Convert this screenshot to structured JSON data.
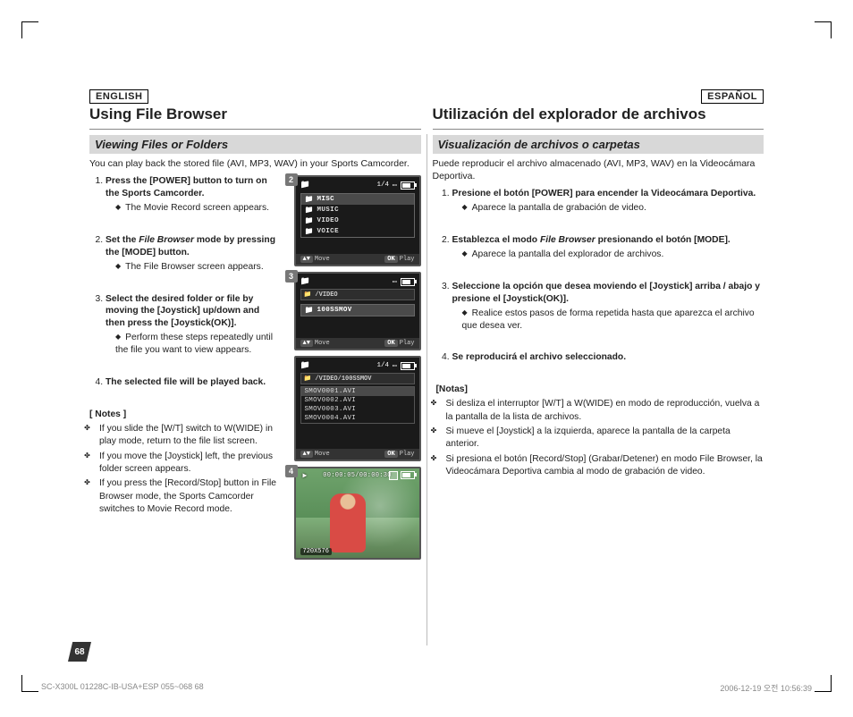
{
  "page_number": "68",
  "footer": {
    "doc_id": "SC-X300L 01228C-IB-USA+ESP 055~068   68",
    "timestamp": "2006-12-19   오전 10:56:39"
  },
  "figures": {
    "step_labels": [
      "2",
      "3",
      "4"
    ],
    "counter": "1/4",
    "folders": [
      "MISC",
      "MUSIC",
      "VIDEO",
      "VOICE"
    ],
    "path_step3": "/VIDEO",
    "path_step3_sub": "100SSMOV",
    "path_step4": "/VIDEO/100SSMOV",
    "files": [
      "SMOV0001.AVI",
      "SMOV0002.AVI",
      "SMOV0003.AVI",
      "SMOV0004.AVI"
    ],
    "bottom_move": "Move",
    "bottom_play": "Play",
    "move_key": "▲▼",
    "ok_key": "OK",
    "play_time": "00:00:05/00:00:30",
    "resolution": "720X576"
  },
  "left": {
    "lang": "ENGLISH",
    "title": "Using File Browser",
    "subheading": "Viewing Files or Folders",
    "intro": "You can play back the stored file (AVI, MP3, WAV) in your Sports Camcorder.",
    "steps": [
      {
        "title": "Press the [POWER] button to turn on the Sports Camcorder.",
        "sub": [
          "The Movie Record screen appears."
        ],
        "mode_label": null
      },
      {
        "title_pre": "Set the ",
        "mode_label": "File Browser",
        "title_post": " mode by pressing the [MODE] button.",
        "sub": [
          "The File Browser screen appears."
        ]
      },
      {
        "title": "Select the desired folder or file by moving the [Joystick] up/down and then press the [Joystick(OK)].",
        "sub": [
          "Perform these steps repeatedly until the file you want to view appears."
        ]
      },
      {
        "title": "The selected file will be played back.",
        "sub": []
      }
    ],
    "notes_head": "[ Notes ]",
    "notes": [
      "If you slide the [W/T] switch to W(WIDE) in play mode, return to the file list screen.",
      "If you move the [Joystick] left, the previous folder screen appears.",
      "If you press the [Record/Stop] button in File Browser mode, the Sports Camcorder switches to Movie Record mode."
    ]
  },
  "right": {
    "lang": "ESPAÑOL",
    "title": "Utilización del explorador de archivos",
    "subheading": "Visualización de archivos o carpetas",
    "intro": "Puede reproducir el archivo almacenado (AVI, MP3, WAV) en la Videocámara Deportiva.",
    "steps": [
      {
        "title": "Presione el botón [POWER] para encender la Videocámara Deportiva.",
        "sub": [
          "Aparece la pantalla de grabación de video."
        ]
      },
      {
        "title_pre": "Establezca el modo ",
        "mode_label": "File Browser",
        "title_post": " presionando el botón [MODE].",
        "sub": [
          "Aparece la pantalla del explorador de archivos."
        ]
      },
      {
        "title": "Seleccione la opción que desea moviendo el [Joystick] arriba / abajo y presione el [Joystick(OK)].",
        "sub": [
          "Realice estos pasos de forma repetida hasta que aparezca el archivo que desea ver."
        ]
      },
      {
        "title": "Se reproducirá el archivo seleccionado.",
        "sub": []
      }
    ],
    "notes_head": "[Notas]",
    "notes": [
      "Si desliza el interruptor [W/T] a W(WIDE) en modo de reproducción, vuelva a la pantalla de la lista de archivos.",
      "Si mueve el [Joystick] a la izquierda, aparece la pantalla de la carpeta anterior.",
      "Si presiona el botón [Record/Stop] (Grabar/Detener) en modo File Browser, la Videocámara Deportiva cambia al modo de grabación de video."
    ]
  }
}
